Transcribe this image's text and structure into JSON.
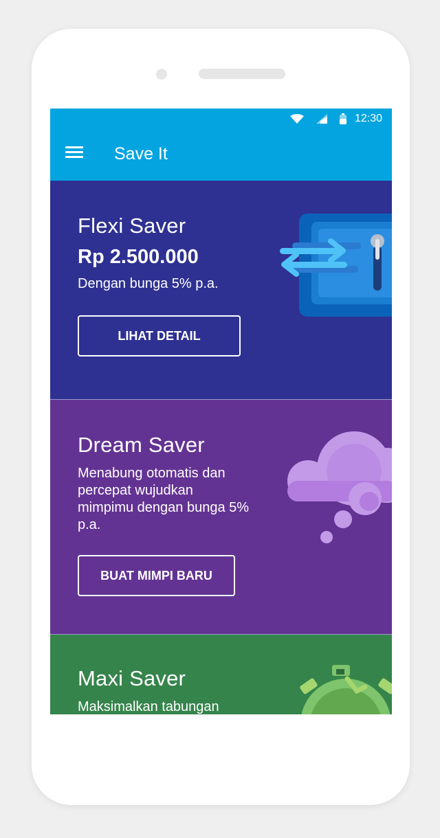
{
  "status_bar": {
    "time": "12:30",
    "icons": [
      "wifi-icon",
      "signal-icon",
      "battery-icon"
    ]
  },
  "app_bar": {
    "title": "Save It",
    "menu_icon": "hamburger-menu-icon"
  },
  "cards": [
    {
      "title": "Flexi Saver",
      "amount": "Rp 2.500.000",
      "description": "Dengan bunga 5% p.a.",
      "button_label": "LIHAT DETAIL",
      "illustration": "safe-icon",
      "color": "#2e3192"
    },
    {
      "title": "Dream Saver",
      "description_lines": [
        "Menabung otomatis dan",
        "percepat wujudkan",
        "mimpimu dengan bunga 5%",
        "p.a."
      ],
      "button_label": "BUAT MIMPI BARU",
      "illustration": "cloud-icon",
      "color": "#633393"
    },
    {
      "title": "Maxi Saver",
      "description": "Maksimalkan tabungan",
      "illustration": "stopwatch-icon",
      "color": "#35844b"
    }
  ],
  "colors": {
    "app_bar": "#03a4e0",
    "background": "#efefef"
  }
}
